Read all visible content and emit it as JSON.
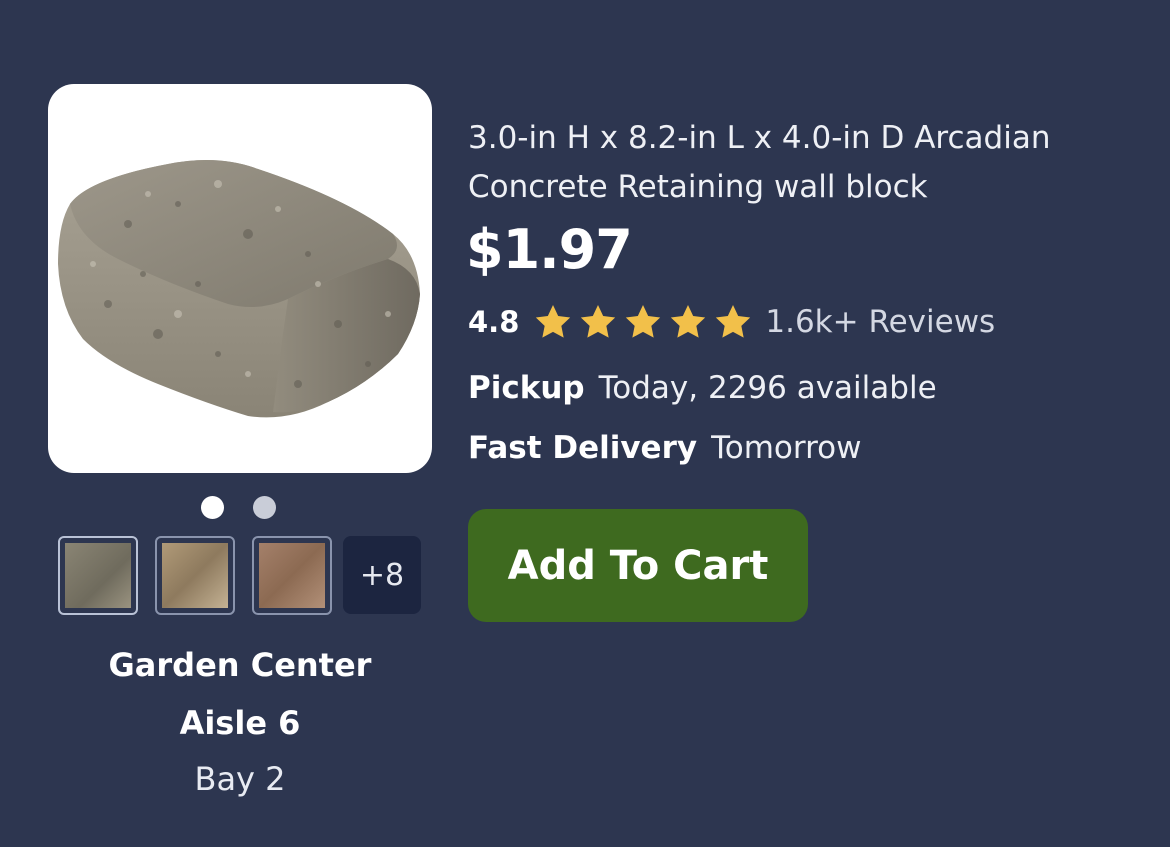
{
  "product": {
    "title": "3.0-in H x 8.2-in L x 4.0-in D Arcadian Concrete Retaining wall block",
    "price": "$1.97",
    "rating_value": "4.8",
    "rating_stars": 5,
    "reviews": "1.6k+ Reviews"
  },
  "gallery": {
    "image_icon": "retaining-wall-block-image",
    "dots": [
      {
        "state": "active"
      },
      {
        "state": "inactive"
      }
    ],
    "thumbnails": [
      {
        "name": "thumb-gray",
        "color": "#8c8676"
      },
      {
        "name": "thumb-tan",
        "color": "#a89070"
      },
      {
        "name": "thumb-brown",
        "color": "#9c7b62"
      }
    ],
    "more_label": "+8"
  },
  "location": {
    "department": "Garden Center",
    "aisle": "Aisle 6",
    "bay": "Bay 2"
  },
  "fulfillment": {
    "pickup_label": "Pickup",
    "pickup_value": "Today, 2296 available",
    "delivery_label": "Fast Delivery",
    "delivery_value": "Tomorrow"
  },
  "actions": {
    "add_to_cart": "Add To Cart"
  },
  "colors": {
    "background": "#2d3650",
    "button": "#3e6a1f",
    "star": "#f2c04a"
  }
}
